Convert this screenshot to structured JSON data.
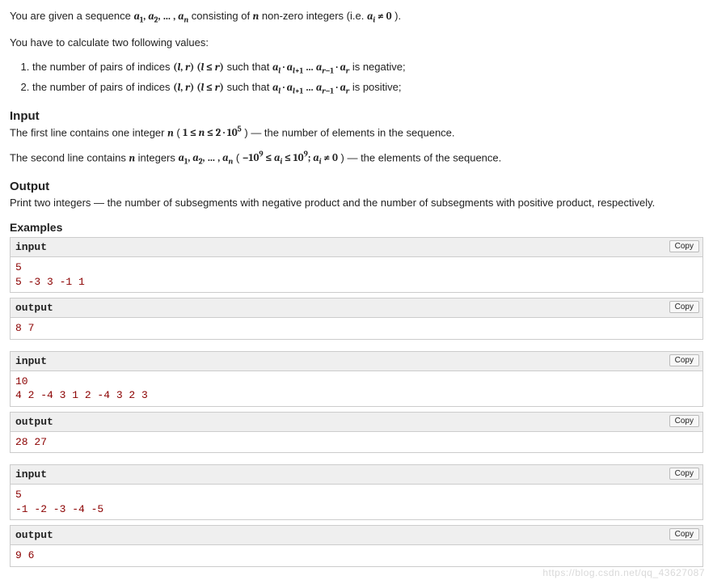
{
  "intro": {
    "p1_prefix": "You are given a sequence ",
    "p1_seq": "a₁, a₂, … , aₙ",
    "p1_mid": " consisting of ",
    "p1_n": "n",
    "p1_rest": " non-zero integers (i.e. ",
    "p1_cond": "aᵢ ≠ 0",
    "p1_end": ").",
    "p2": "You have to calculate two following values:",
    "li1_a": "the number of pairs of indices ",
    "li_pair": "(l, r) (l ≤ r)",
    "li1_b": " such that ",
    "li_prod": "aₗ · aₗ₊₁ … aᵣ₋₁ · aᵣ",
    "li1_c": " is negative;",
    "li2_a": "the number of pairs of indices ",
    "li2_b": " such that ",
    "li2_c": " is positive;"
  },
  "input": {
    "heading": "Input",
    "p1_a": "The first line contains one integer ",
    "p1_n": "n",
    "p1_b": " (",
    "p1_range": "1 ≤ n ≤ 2 · 10⁵",
    "p1_c": ") — the number of elements in the sequence.",
    "p2_a": "The second line contains ",
    "p2_n": "n",
    "p2_b": " integers ",
    "p2_seq": "a₁, a₂, … , aₙ",
    "p2_c": " (",
    "p2_range": "−10⁹ ≤ aᵢ ≤ 10⁹; aᵢ ≠ 0",
    "p2_d": ") — the elements of the sequence."
  },
  "output": {
    "heading": "Output",
    "p": "Print two integers — the number of subsegments with negative product and the number of subsegments with positive product, respectively."
  },
  "examples": {
    "heading": "Examples",
    "input_label": "input",
    "output_label": "output",
    "copy_label": "Copy",
    "cases": [
      {
        "in": "5\n5 -3 3 -1 1",
        "out": "8 7"
      },
      {
        "in": "10\n4 2 -4 3 1 2 -4 3 2 3",
        "out": "28 27"
      },
      {
        "in": "5\n-1 -2 -3 -4 -5",
        "out": "9 6"
      }
    ]
  },
  "watermark": "https://blog.csdn.net/qq_43627087"
}
